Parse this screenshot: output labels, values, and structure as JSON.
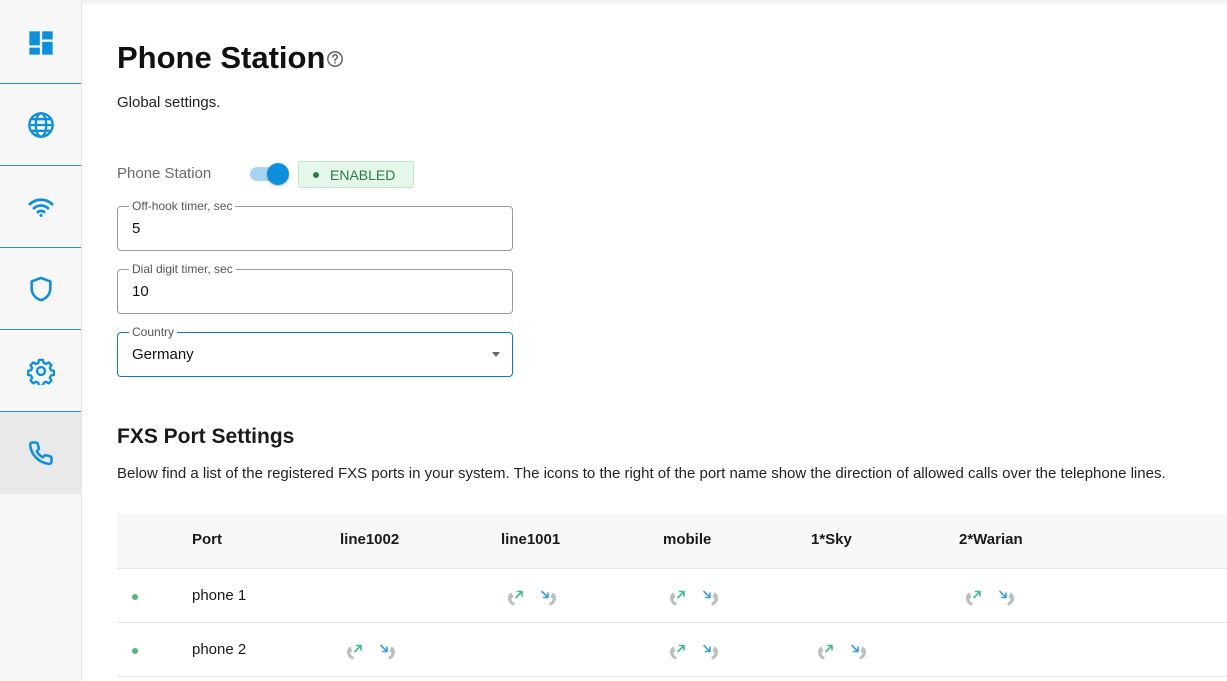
{
  "sidebar": {
    "items": [
      {
        "name": "dashboard",
        "icon": "dashboard-icon",
        "active": false
      },
      {
        "name": "internet",
        "icon": "globe-icon",
        "active": false
      },
      {
        "name": "wifi",
        "icon": "wifi-icon",
        "active": false
      },
      {
        "name": "security",
        "icon": "shield-icon",
        "active": false
      },
      {
        "name": "settings",
        "icon": "gear-icon",
        "active": false
      },
      {
        "name": "telephony",
        "icon": "phone-icon",
        "active": true
      }
    ]
  },
  "page": {
    "title": "Phone Station",
    "help_icon": "help-circle-icon",
    "subtitle": "Global settings."
  },
  "settings": {
    "toggle_label": "Phone Station",
    "toggle_on": true,
    "status_badge": "ENABLED",
    "off_hook": {
      "label": "Off-hook timer, sec",
      "value": "5"
    },
    "dial_digit": {
      "label": "Dial digit timer, sec",
      "value": "10"
    },
    "country": {
      "label": "Country",
      "value": "Germany"
    }
  },
  "fxs": {
    "title": "FXS Port Settings",
    "description": "Below find a list of the registered FXS ports in your system. The icons to the right of the port name show the direction of allowed calls over the telephone lines.",
    "columns": [
      "Port",
      "line1002",
      "line1001",
      "mobile",
      "1*Sky",
      "2*Warian"
    ],
    "rows": [
      {
        "port": "phone 1",
        "status": "online",
        "lines": [
          false,
          true,
          true,
          false,
          true
        ]
      },
      {
        "port": "phone 2",
        "status": "online",
        "lines": [
          true,
          false,
          true,
          true,
          false
        ]
      }
    ]
  },
  "colors": {
    "accent": "#0e8fdb",
    "enabled_text": "#2a7d47",
    "enabled_bg": "#e5f6ea",
    "status_online": "#58b87a",
    "call_out_arrow": "#3cb98a",
    "call_in_arrow": "#3a9ed8"
  }
}
